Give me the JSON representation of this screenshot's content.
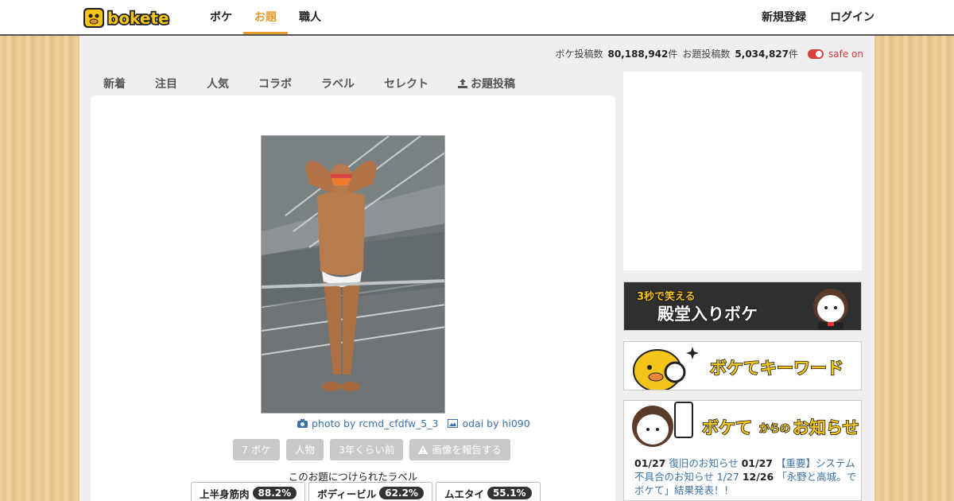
{
  "header": {
    "logo_text": "bokete",
    "nav": [
      "ボケ",
      "お題",
      "職人"
    ],
    "active_nav": "お題",
    "signup": "新規登録",
    "login": "ログイン"
  },
  "stats": {
    "boke_label": "ボケ投稿数",
    "boke_count": "80,188,942",
    "boke_unit": "件",
    "odai_label": "お題投稿数",
    "odai_count": "5,034,827",
    "odai_unit": "件",
    "safe": "safe on"
  },
  "tabs": [
    "新着",
    "注目",
    "人気",
    "コラボ",
    "ラベル",
    "セレクト",
    "お題投稿"
  ],
  "odai": {
    "photo_credit": "photo by rcmd_cfdfw_5_3",
    "odai_credit": "odai by hi090",
    "boke_count": "7 ボケ",
    "category": "人物",
    "age": "3年くらい前",
    "report": "画像を報告する",
    "labels_caption": "このお題につけられたラベル",
    "labels": [
      {
        "name": "上半身筋肉",
        "pct": "88.2%"
      },
      {
        "name": "ボディービル",
        "pct": "62.2%"
      },
      {
        "name": "ムエタイ",
        "pct": "55.1%"
      }
    ]
  },
  "sidebar": {
    "banner1_small": "3秒で笑える",
    "banner1_big": "殿堂入りボケ",
    "banner2": "ボケてキーワード",
    "banner3_a": "ボケて",
    "banner3_b": "からの",
    "banner3_c": "お知らせ",
    "news": [
      {
        "date": "01/27",
        "text": "復旧のお知らせ"
      },
      {
        "date": "01/27",
        "text": "【重要】システム不具合のお知らせ"
      },
      {
        "date": "1/27",
        "text": ""
      },
      {
        "date": "12/26",
        "text": "「永野と高城。でボケて」結果発表！！"
      }
    ]
  },
  "colors": {
    "accent": "#e69d2d",
    "link": "#3b73a8",
    "safe": "#d84040"
  }
}
